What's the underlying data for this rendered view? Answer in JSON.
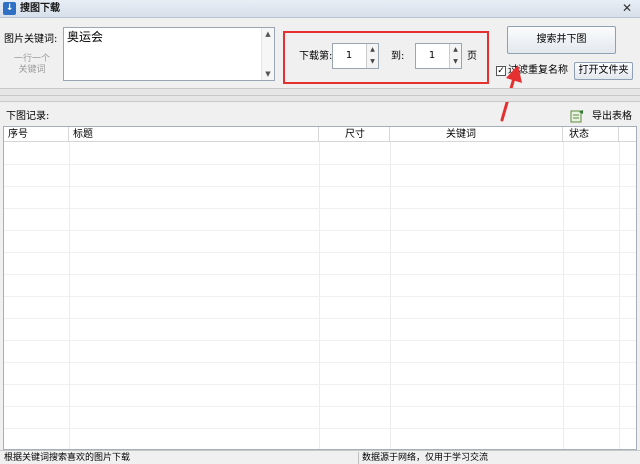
{
  "window": {
    "title": "搜图下载",
    "close_glyph": "✕"
  },
  "keyword": {
    "label": "图片关键词:",
    "hint": "一行一个关键词",
    "value": "奥运会"
  },
  "range": {
    "from_label": "下载第:",
    "from_value": "1",
    "to_label": "到:",
    "to_value": "1",
    "unit_label": "页"
  },
  "actions": {
    "search_label": "搜索并下图",
    "filter_label": "过滤重复名称",
    "filter_checked": true,
    "open_folder_label": "打开文件夹"
  },
  "records": {
    "label": "下图记录:",
    "export_label": "导出表格",
    "columns": [
      "序号",
      "标题",
      "尺寸",
      "关键词",
      "状态"
    ],
    "rows": []
  },
  "status": {
    "left": "根据关键词搜索喜欢的图片下载",
    "right": "数据源于网络，仅用于学习交流"
  },
  "colors": {
    "highlight": "#e53030",
    "accent": "#2f6fc4"
  }
}
